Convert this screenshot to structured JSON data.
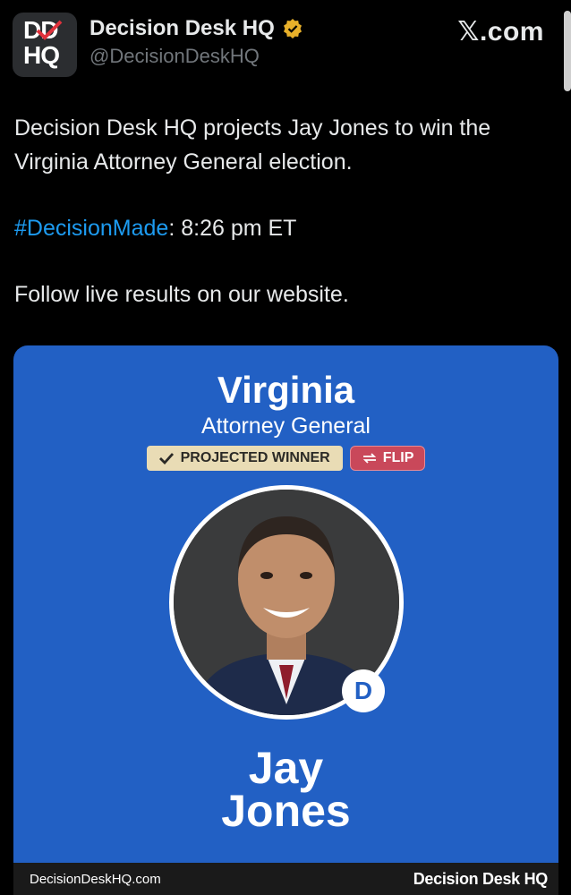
{
  "header": {
    "avatar_top": "DD",
    "avatar_bottom": "HQ",
    "name": "Decision Desk HQ",
    "handle": "@DecisionDeskHQ",
    "verified_icon": "verified-badge-gold",
    "site_logo": "𝕏.com"
  },
  "tweet": {
    "line1": "Decision Desk HQ projects Jay Jones to win the Virginia Attorney General election.",
    "hashtag": "#DecisionMade",
    "hashtag_rest": ": 8:26 pm ET",
    "line3": "Follow live results on our website."
  },
  "card": {
    "state": "Virginia",
    "office": "Attorney General",
    "winner_badge": "PROJECTED WINNER",
    "flip_badge": "FLIP",
    "party": "D",
    "candidate_first": "Jay",
    "candidate_last": "Jones",
    "footer_url": "DecisionDeskHQ.com",
    "footer_brand": "Decision Desk HQ"
  },
  "colors": {
    "card_bg": "#2260c4",
    "hashtag": "#1d9bf0",
    "winner_badge": "#e9dcb5",
    "flip_badge": "#c9485a"
  }
}
